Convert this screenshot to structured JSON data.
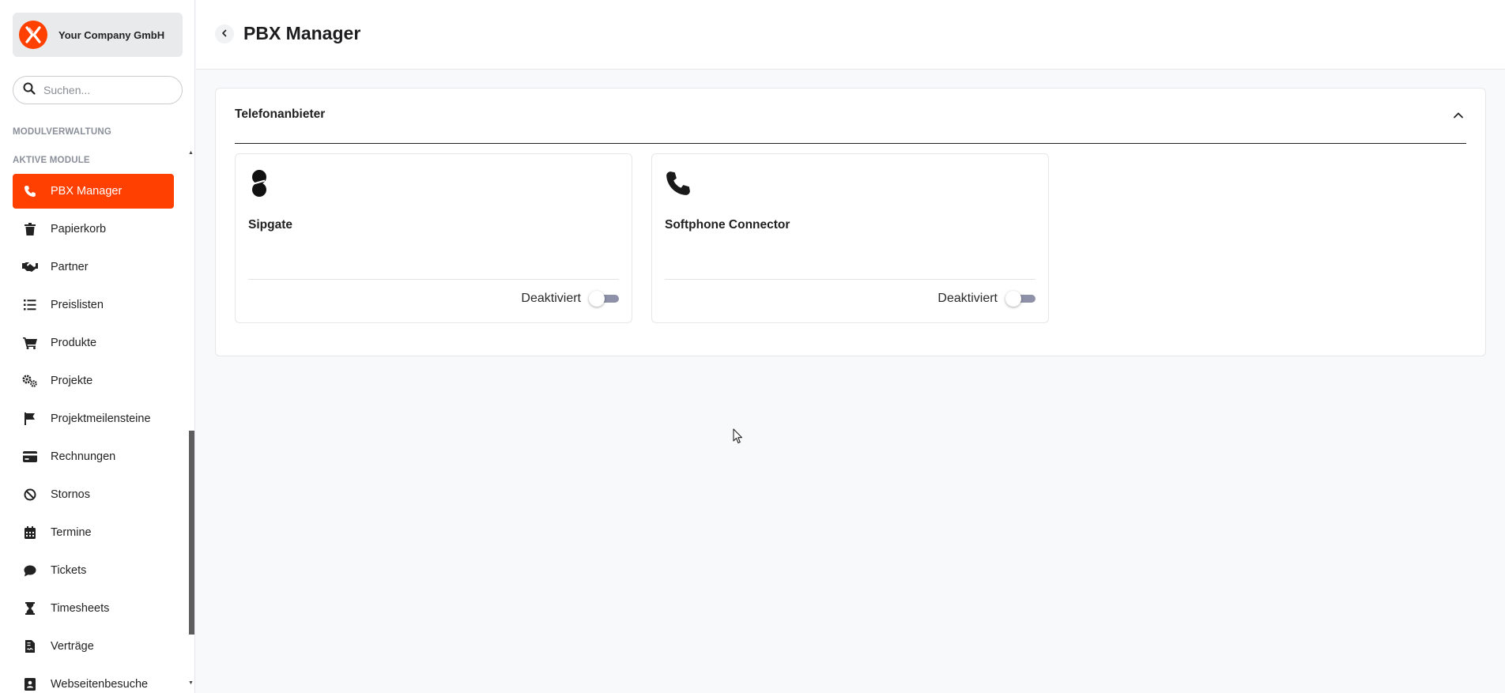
{
  "company": {
    "name": "Your Company GmbH"
  },
  "search": {
    "placeholder": "Suchen..."
  },
  "sidebar": {
    "section_module_admin": "MODULVERWALTUNG",
    "section_active_modules": "AKTIVE MODULE",
    "items": [
      {
        "label": "PBX Manager",
        "icon": "phone-icon",
        "active": true
      },
      {
        "label": "Papierkorb",
        "icon": "trash-icon",
        "active": false
      },
      {
        "label": "Partner",
        "icon": "handshake-icon",
        "active": false
      },
      {
        "label": "Preislisten",
        "icon": "list-icon",
        "active": false
      },
      {
        "label": "Produkte",
        "icon": "cart-icon",
        "active": false
      },
      {
        "label": "Projekte",
        "icon": "gears-icon",
        "active": false
      },
      {
        "label": "Projektmeilensteine",
        "icon": "flag-icon",
        "active": false
      },
      {
        "label": "Rechnungen",
        "icon": "credit-card-icon",
        "active": false
      },
      {
        "label": "Stornos",
        "icon": "ban-icon",
        "active": false
      },
      {
        "label": "Termine",
        "icon": "calendar-icon",
        "active": false
      },
      {
        "label": "Tickets",
        "icon": "comment-icon",
        "active": false
      },
      {
        "label": "Timesheets",
        "icon": "hourglass-icon",
        "active": false
      },
      {
        "label": "Verträge",
        "icon": "contract-icon",
        "active": false
      },
      {
        "label": "Webseitenbesuche",
        "icon": "address-card-icon",
        "active": false
      }
    ]
  },
  "header": {
    "title": "PBX Manager"
  },
  "panel": {
    "title": "Telefonanbieter",
    "cards": [
      {
        "name": "Sipgate",
        "icon": "sipgate-logo-icon",
        "status": "Deaktiviert",
        "enabled": false
      },
      {
        "name": "Softphone Connector",
        "icon": "phone-icon",
        "status": "Deaktiviert",
        "enabled": false
      }
    ]
  },
  "colors": {
    "accent": "#ff4000",
    "toggle_off": "#8e91a8"
  }
}
